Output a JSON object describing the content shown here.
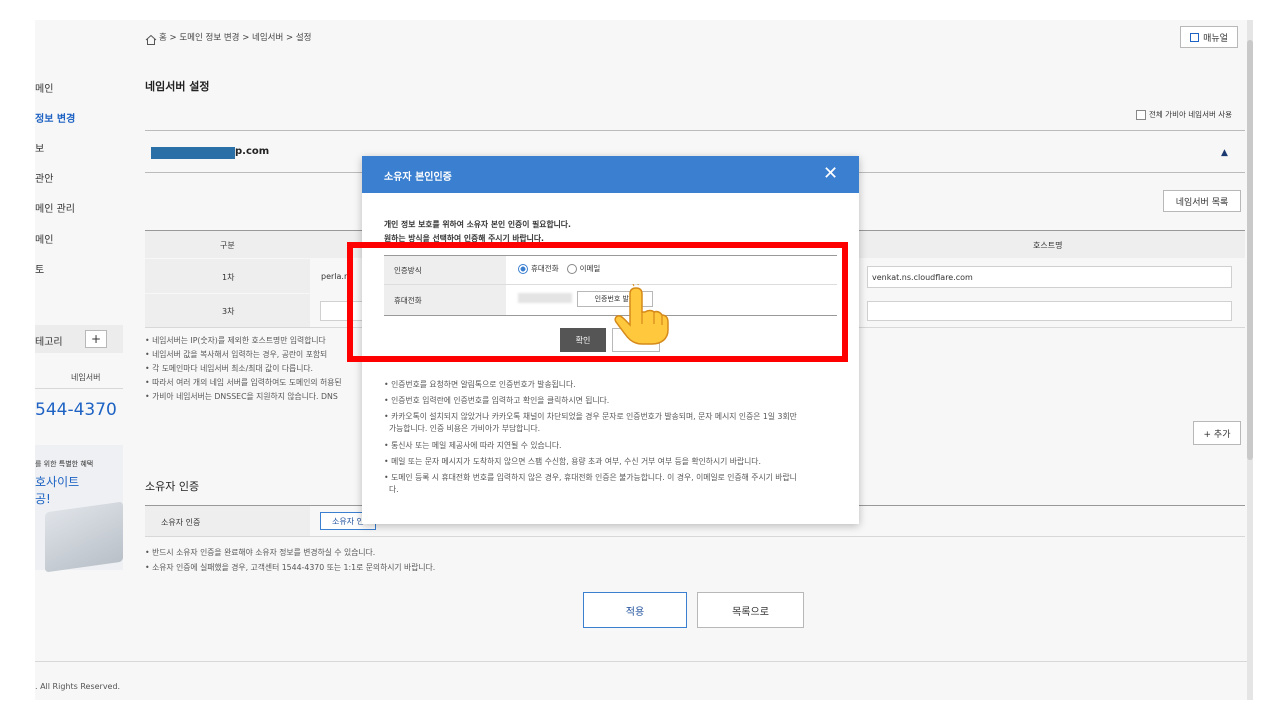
{
  "breadcrumb": "홈 > 도메인 정보 변경 > 네임서버 > 설정",
  "manual_button": "매뉴얼",
  "page_title": "네임서버 설정",
  "use_all_nameserver_label": "전체 가비아 네임서버 사용",
  "domain_name": "p.com",
  "nameserver_list_button": "네임서버 목록",
  "sidebar": {
    "items": [
      "메인",
      "정보 변경",
      "보",
      "관안",
      "메인 관리",
      "메인",
      "토"
    ],
    "category_label": "테고리",
    "plus": "+",
    "nameserver_tab": "네임서버",
    "phone": "544-4370",
    "promo_line1": "를 위한 특별한 혜택",
    "promo_line2": "호사이트",
    "promo_line3": "공!"
  },
  "table": {
    "col1": "구분",
    "col_host": "호스트명",
    "rows": [
      {
        "label": "1차",
        "ns_prefix": "perla.n",
        "host": "venkat.ns.cloudflare.com"
      },
      {
        "label": "3차",
        "ns_prefix": "",
        "host": ""
      }
    ]
  },
  "notes_left": [
    "• 네임서버는 IP(숫자)를 제외한 호스트명만 입력합니다",
    "• 네임서버 값을 복사해서 입력하는 경우, 공란이 포함되",
    "• 각 도메인마다 네임서버 최소/최대 값이 다릅니다.",
    "• 따라서 여러 개의 네임 서버를 입력하여도 도메인의 허용된",
    "• 가비아 네임서버는 DNSSEC을 지원하지 않습니다. DNS"
  ],
  "add_button": "+ 추가",
  "owner_section": {
    "title": "소유자 인증",
    "row_label": "소유자 인증",
    "verify_button": "소유자 인",
    "notes": [
      "• 반드시 소유자 인증을 완료해야 소유자 정보를 변경하실 수 있습니다.",
      "• 소유자 인증에 실패했을 경우, 고객센터 1544-4370 또는 1:1로 문의하시기 바랍니다."
    ]
  },
  "apply_button": "적용",
  "list_button": "목록으로",
  "footer": ". All Rights Reserved.",
  "modal": {
    "title": "소유자 본인인증",
    "close": "✕",
    "intro1": "개인 정보 보호를 위하여 소유자 본인 인증이 필요합니다.",
    "intro2": "원하는 방식을 선택하여 인증해 주시기 바랍니다.",
    "method_label": "인증방식",
    "option_phone": "휴대전화",
    "option_email": "이메일",
    "phone_label": "휴대전화",
    "send_code_button": "인증번호 발송",
    "confirm_button": "확인",
    "cancel_button": "",
    "notes": [
      "• 인증번호를 요청하면 알림톡으로 인증번호가 발송됩니다.",
      "• 인증번호 입력란에 인증번호를 입력하고 확인을 클릭하시면 됩니다.",
      "• 카카오톡이 설치되지 않았거나 카카오톡 채널이 차단되었을 경우 문자로 인증번호가 발송되며, 문자 메시지 인증은 1일 3회만",
      "  가능합니다. 인증 비용은 가비아가 부담합니다.",
      "• 통신사 또는 메일 제공사에 따라 지연될 수 있습니다.",
      "• 메일 또는 문자 메시지가 도착하지 않으면 스팸 수신함, 용량 초과 여부, 수신 거부 여부 등을 확인하시기 바랍니다.",
      "• 도메인 등록 시 휴대전화 번호를 입력하지 않은 경우, 휴대전화 인증은 불가능합니다. 이 경우, 이메일로 인증해 주시기 바랍니",
      "  다."
    ]
  },
  "colors": {
    "modal_header": "#3a7fd0",
    "highlight": "#ff0000",
    "link_blue": "#1e63c4"
  }
}
